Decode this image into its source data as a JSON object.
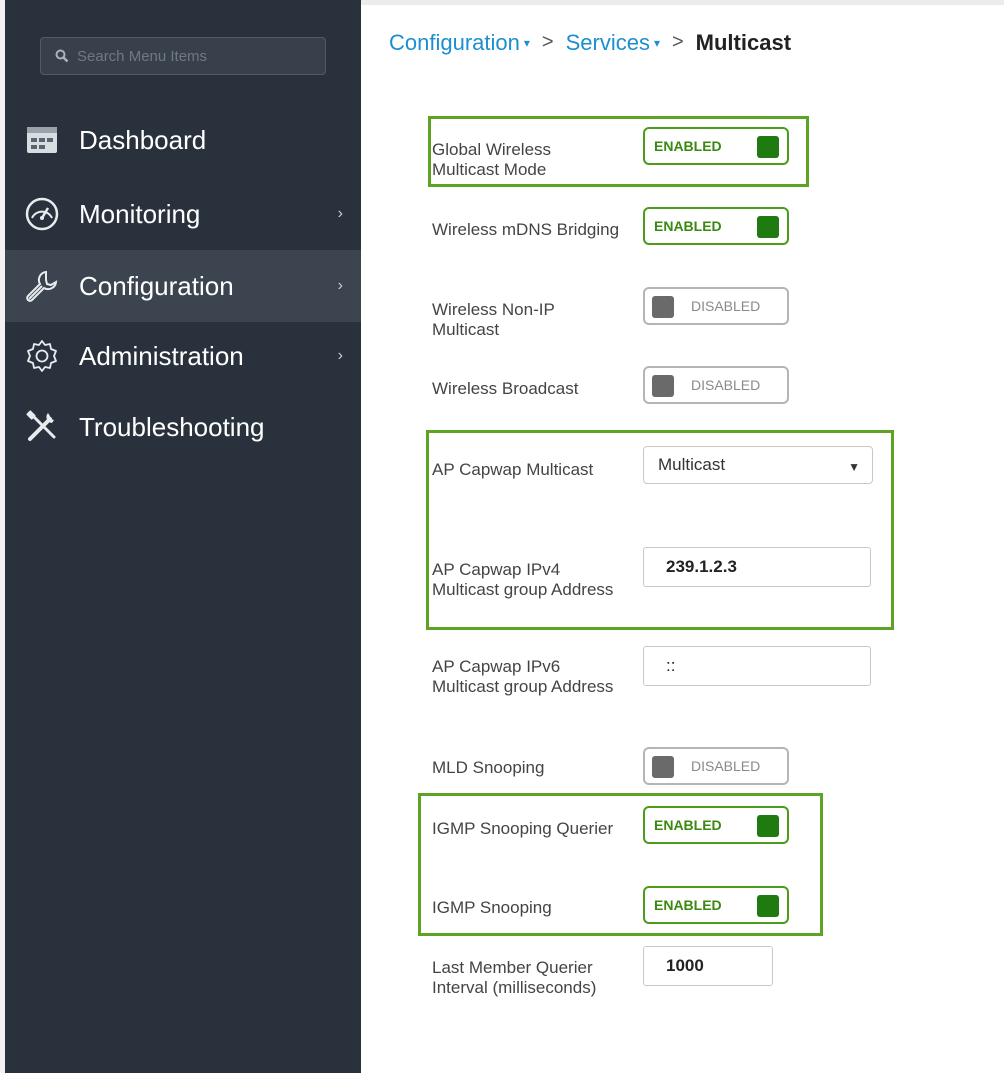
{
  "search": {
    "placeholder": "Search Menu Items"
  },
  "nav": {
    "items": [
      {
        "label": "Dashboard",
        "icon": "dashboard-icon",
        "has_arrow": false
      },
      {
        "label": "Monitoring",
        "icon": "monitoring-gauge-icon",
        "has_arrow": true
      },
      {
        "label": "Configuration",
        "icon": "wrench-icon",
        "has_arrow": true,
        "active": true
      },
      {
        "label": "Administration",
        "icon": "gear-icon",
        "has_arrow": true
      },
      {
        "label": "Troubleshooting",
        "icon": "tools-icon",
        "has_arrow": false
      }
    ]
  },
  "breadcrumb": {
    "level1": "Configuration",
    "level2": "Services",
    "current": "Multicast"
  },
  "form": {
    "global_wireless_multicast": {
      "label": "Global Wireless Multicast Mode",
      "state": "ENABLED"
    },
    "wireless_mdns_bridging": {
      "label": "Wireless mDNS Bridging",
      "state": "ENABLED"
    },
    "wireless_non_ip_multicast": {
      "label": "Wireless Non-IP Multicast",
      "state": "DISABLED"
    },
    "wireless_broadcast": {
      "label": "Wireless Broadcast",
      "state": "DISABLED"
    },
    "ap_capwap_multicast": {
      "label": "AP Capwap Multicast",
      "value": "Multicast"
    },
    "ap_capwap_ipv4": {
      "label": "AP Capwap IPv4 Multicast group Address",
      "value": "239.1.2.3"
    },
    "ap_capwap_ipv6": {
      "label": "AP Capwap IPv6 Multicast group Address",
      "value": "::"
    },
    "mld_snooping": {
      "label": "MLD Snooping",
      "state": "DISABLED"
    },
    "igmp_snooping_querier": {
      "label": "IGMP Snooping Querier",
      "state": "ENABLED"
    },
    "igmp_snooping": {
      "label": "IGMP Snooping",
      "state": "ENABLED"
    },
    "last_member_querier_interval": {
      "label": "Last Member Querier Interval (milliseconds)",
      "value": "1000"
    }
  },
  "colors": {
    "sidebar_bg": "#29323c",
    "active_bg": "#3b444f",
    "link_blue": "#1d8fd1",
    "enabled_green": "#1f7a10",
    "highlight_green": "#5ea424"
  }
}
